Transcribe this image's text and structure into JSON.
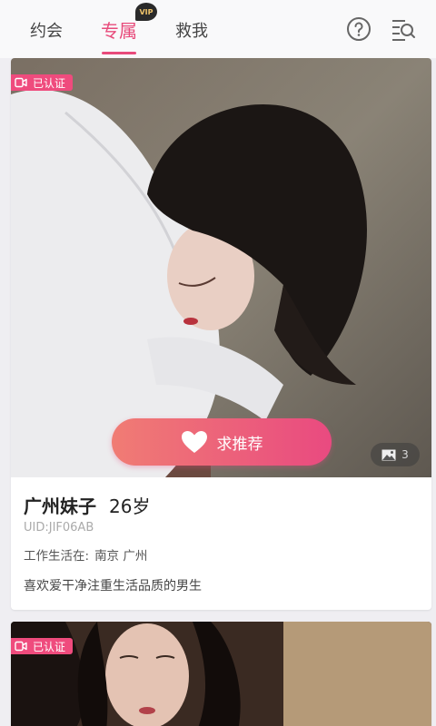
{
  "tabs": [
    {
      "label": "约会"
    },
    {
      "label": "专属",
      "active": true,
      "badge": "VIP"
    },
    {
      "label": "救我"
    }
  ],
  "icons": {
    "help": "help-circle-icon",
    "filter": "filter-search-icon",
    "video": "video-camera-icon",
    "heart": "heart-icon",
    "image": "image-icon"
  },
  "cards": [
    {
      "verified_label": "已认证",
      "recommend_label": "求推荐",
      "photo_count": "3",
      "name": "广州妹子",
      "age": "26岁",
      "uid": "UID:JIF06AB",
      "location_label": "工作生活在:",
      "cities": "南京 广州",
      "bio": "喜欢爱干净注重生活品质的男生"
    },
    {
      "verified_label": "已认证"
    }
  ],
  "colors": {
    "accent": "#e84b7b",
    "gradient_start": "#f07c74",
    "gradient_end": "#e94a80"
  }
}
